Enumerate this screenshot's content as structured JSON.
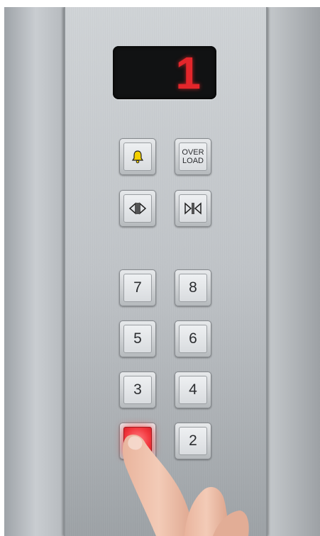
{
  "display": {
    "floor": "1"
  },
  "buttons": {
    "alarm_icon": "bell-icon",
    "overload": {
      "line1": "OVER",
      "line2": "LOAD"
    },
    "door_open_icon": "door-open-icon",
    "door_close_icon": "door-close-icon",
    "floors": [
      {
        "label": "7"
      },
      {
        "label": "8"
      },
      {
        "label": "5"
      },
      {
        "label": "6"
      },
      {
        "label": "3"
      },
      {
        "label": "4"
      },
      {
        "label": ""
      },
      {
        "label": "2"
      }
    ]
  },
  "colors": {
    "display_red": "#e3262b",
    "lit_button": "#f2373d",
    "bell_yellow": "#f4d000"
  }
}
